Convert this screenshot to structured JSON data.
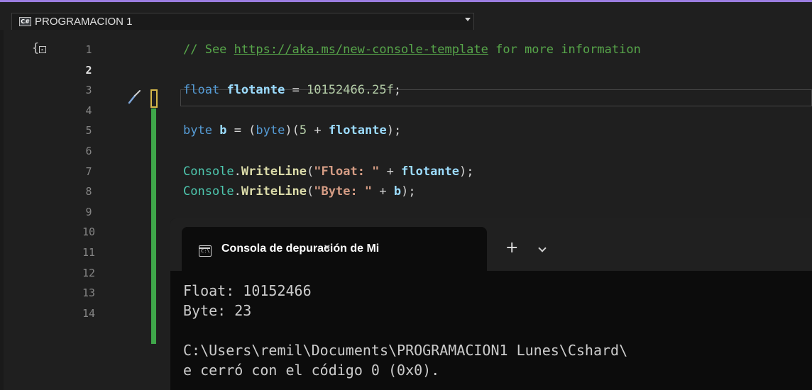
{
  "navbar": {
    "lang_icon": "C#",
    "scope": "PROGRAMACION 1"
  },
  "editor": {
    "line_numbers": [
      "1",
      "2",
      "3",
      "4",
      "5",
      "6",
      "7",
      "8",
      "9",
      "10",
      "11",
      "12",
      "13",
      "14"
    ],
    "current_line": 2,
    "lines": [
      [
        [
          "comment",
          "// See "
        ],
        [
          "link",
          "https://aka.ms/new-console-template"
        ],
        [
          "comment",
          " for more information"
        ]
      ],
      [],
      [
        [
          "kw",
          "float"
        ],
        [
          "punc",
          " "
        ],
        [
          "var",
          "flotante"
        ],
        [
          "punc",
          " = "
        ],
        [
          "num",
          "10152466.25f"
        ],
        [
          "punc",
          ";"
        ]
      ],
      [],
      [
        [
          "kw",
          "byte"
        ],
        [
          "punc",
          " "
        ],
        [
          "var",
          "b"
        ],
        [
          "punc",
          " = ("
        ],
        [
          "kw",
          "byte"
        ],
        [
          "punc",
          ")("
        ],
        [
          "num",
          "5"
        ],
        [
          "punc",
          " + "
        ],
        [
          "var",
          "flotante"
        ],
        [
          "punc",
          ");"
        ]
      ],
      [],
      [
        [
          "cls",
          "Console"
        ],
        [
          "punc",
          "."
        ],
        [
          "mth",
          "WriteLine"
        ],
        [
          "punc",
          "("
        ],
        [
          "str",
          "\"Float: \""
        ],
        [
          "punc",
          " + "
        ],
        [
          "var",
          "flotante"
        ],
        [
          "punc",
          ");"
        ]
      ],
      [
        [
          "cls",
          "Console"
        ],
        [
          "punc",
          "."
        ],
        [
          "mth",
          "WriteLine"
        ],
        [
          "punc",
          "("
        ],
        [
          "str",
          "\"Byte: \""
        ],
        [
          "punc",
          " + "
        ],
        [
          "var",
          "b"
        ],
        [
          "punc",
          ");"
        ]
      ]
    ]
  },
  "terminal": {
    "tab_title": "Consola de depuración de Mi",
    "tab_close": "×",
    "new_tab": "+",
    "icon_text": "C:\\",
    "output": [
      "Float: 10152466",
      "Byte: 23",
      "",
      "C:\\Users\\remil\\Documents\\PROGRAMACION1 Lunes\\Cshard\\",
      "e cerró con el código 0 (0x0)."
    ]
  },
  "colors": {
    "accent": "#9b7de0",
    "change_saved": "#3fa64a",
    "change_unsaved": "#d6b84a"
  },
  "icons": {
    "outline": "brace-outline-icon",
    "brush": "paintbrush-icon",
    "terminal": "terminal-icon",
    "dropdown": "chevron-down-icon"
  }
}
